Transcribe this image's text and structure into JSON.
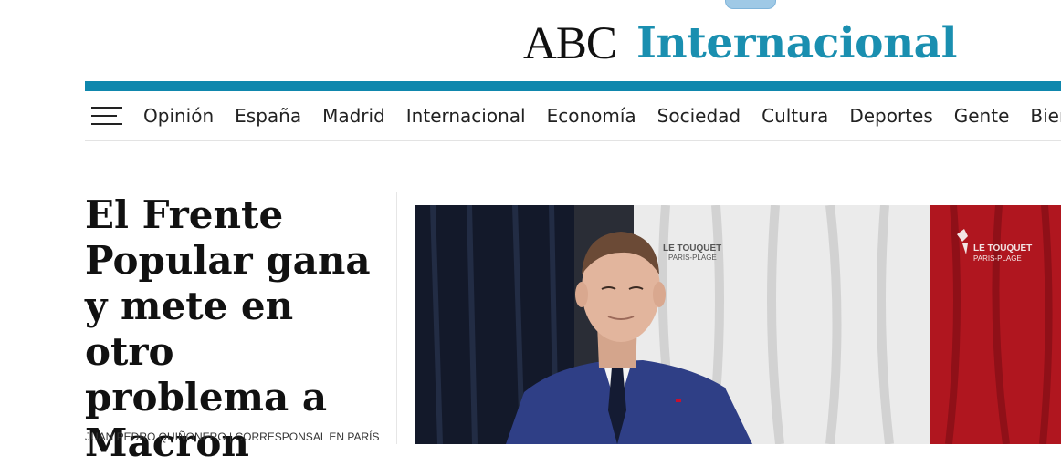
{
  "brand": {
    "name": "ABC",
    "section": "Internacional",
    "colors": {
      "accent": "#0f87ad",
      "section_text": "#1a8fb0"
    }
  },
  "nav": {
    "menu_icon": "hamburger-menu-icon",
    "items": [
      "Opinión",
      "España",
      "Madrid",
      "Internacional",
      "Economía",
      "Sociedad",
      "Cultura",
      "Deportes",
      "Gente",
      "Bienestar"
    ]
  },
  "article": {
    "headline": "El Frente Popular gana y mete en otro problema a Macron",
    "byline": "JUAN PEDRO QUIÑONERO | CORRESPONSAL EN PARÍS"
  },
  "photo": {
    "backdrop_text_1": "LE TOUQUET",
    "backdrop_text_2": "PARIS-PLAGE"
  }
}
